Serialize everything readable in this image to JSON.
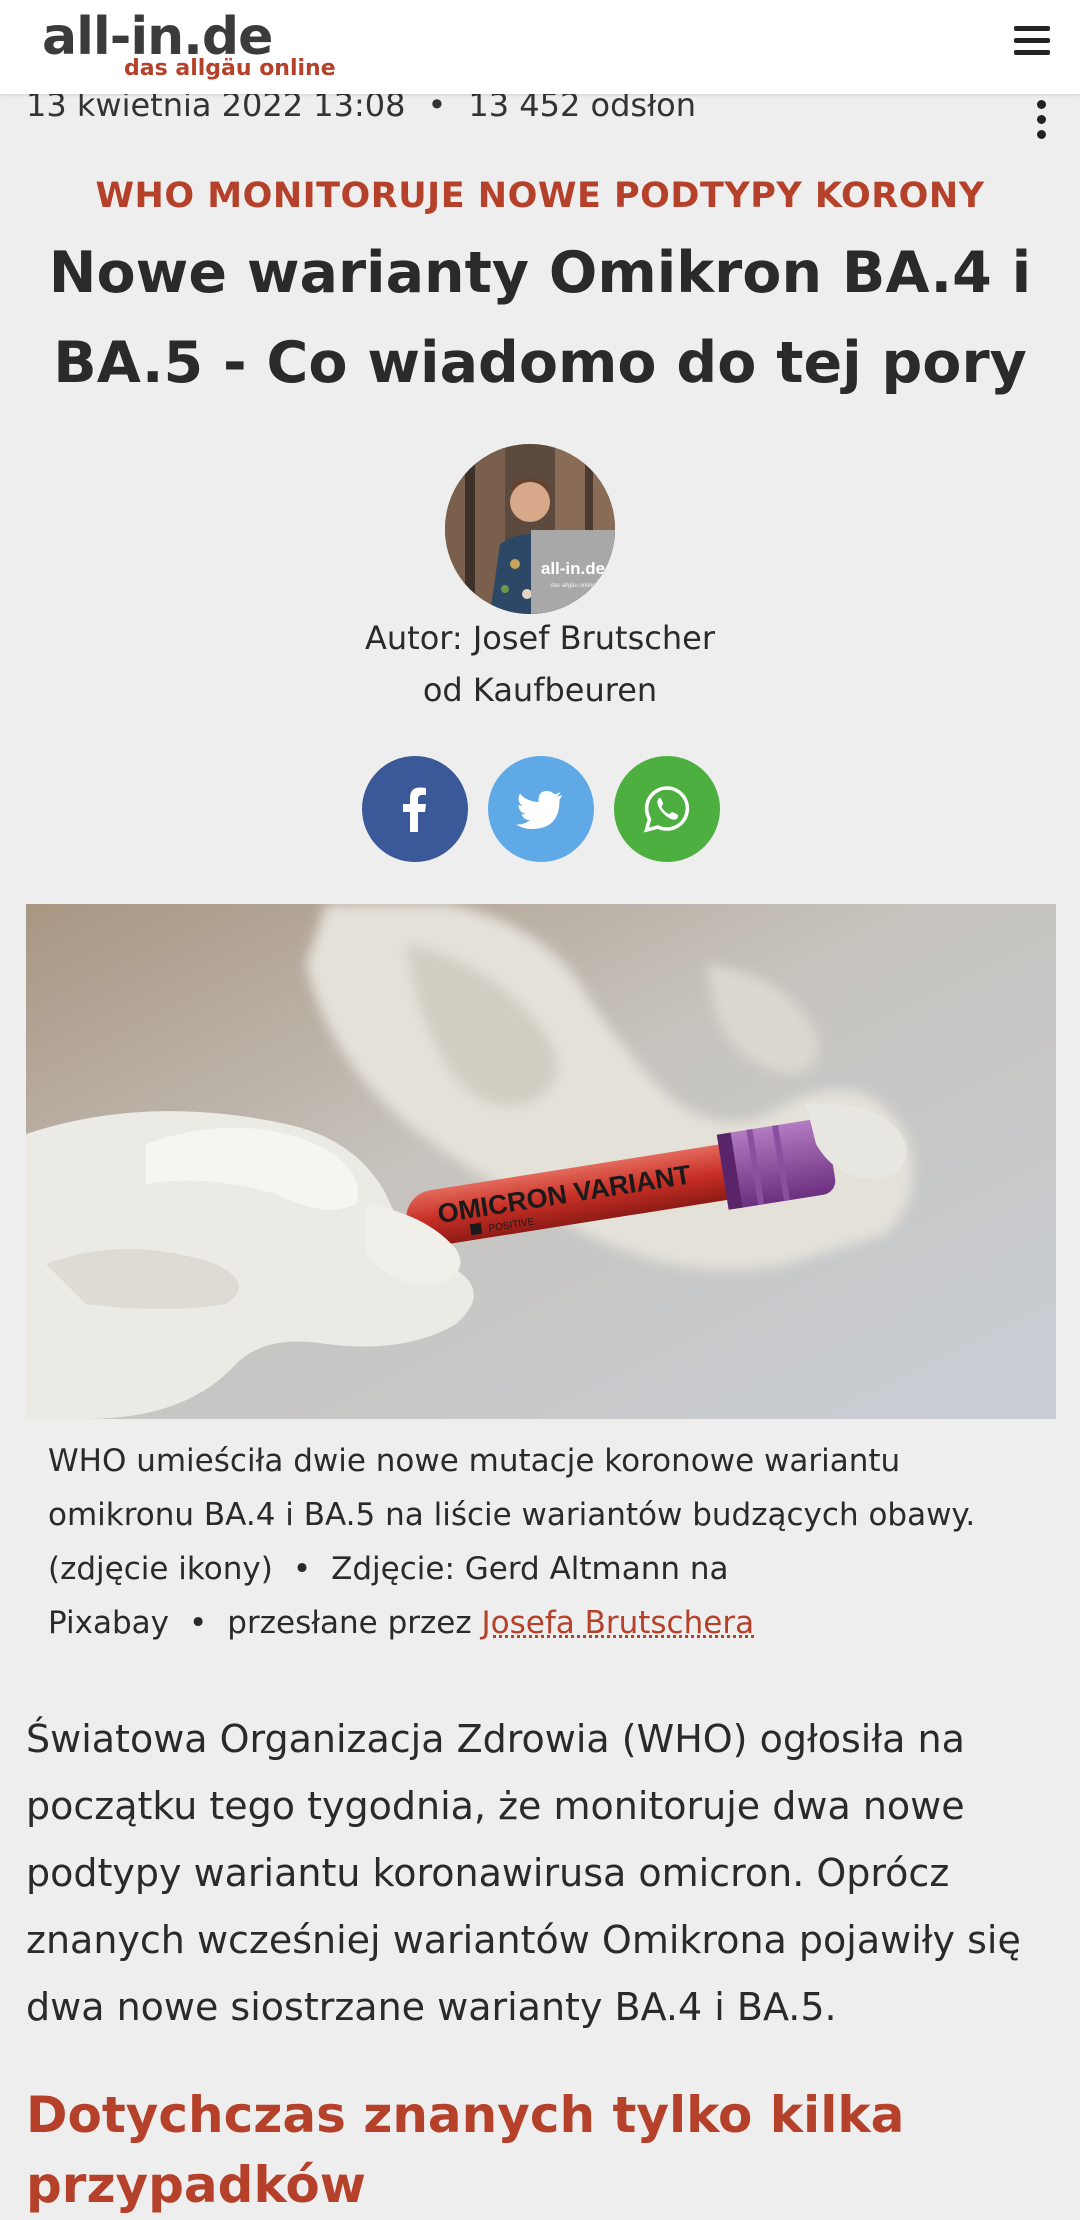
{
  "header": {
    "logo_main": "all-in.de",
    "logo_sub": "das allgäu online"
  },
  "meta": {
    "date": "13 kwietnia 2022 13:08",
    "separator": "•",
    "views": "13 452 odsłon"
  },
  "article": {
    "kicker": "WHO MONITORUJE NOWE PODTYPY KORONY",
    "title": "Nowe warianty Omikron BA.4 i BA.5 - Co wiadomo do tej pory",
    "author_line": "Autor: Josef Brutscher",
    "author_place": "od Kaufbeuren",
    "avatar_badge": "all-in.de",
    "avatar_badge_sub": "das allgäu online",
    "hero_tube_label": "OMICRON VARIANT",
    "hero_tube_sublabel": "POSITIVE",
    "caption": {
      "text": "WHO umieściła dwie nowe mutacje koronowe wariantu omikronu BA.4 i BA.5 na liście wariantów budzących obawy.",
      "icon_note": "(zdjęcie ikony)",
      "separator": "•",
      "photo_credit_1": "Zdjęcie: Gerd Altmann na",
      "photo_credit_2": "Pixabay",
      "uploaded_by": "przesłane przez",
      "uploader_link": "Josefa Brutschera"
    },
    "lead": "Światowa Organizacja Zdrowia (WHO) ogłosiła na początku tego tygodnia, że monitoruje dwa nowe podtypy wariantu koronawirusa omicron. Oprócz znanych wcześniej wariantów Omikrona pojawiły się dwa nowe siostrzane warianty BA.4 i BA.5.",
    "subheading": "Dotychczas znanych tylko kilka przypadków"
  },
  "share": {
    "facebook_icon": "facebook-icon",
    "twitter_icon": "twitter-icon",
    "whatsapp_icon": "whatsapp-icon"
  },
  "colors": {
    "accent": "#b5412a",
    "facebook": "#3b5998",
    "twitter": "#5ea9e6",
    "whatsapp": "#4caf3f",
    "background": "#eeeeee"
  }
}
